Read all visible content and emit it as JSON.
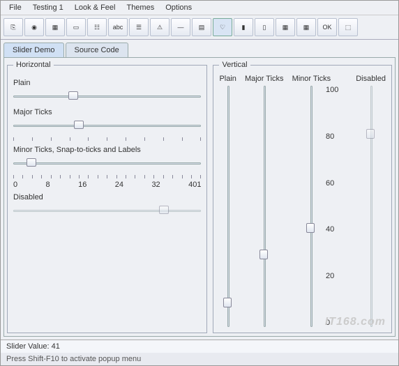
{
  "menu": [
    "File",
    "Testing 1",
    "Look & Feel",
    "Themes",
    "Options"
  ],
  "toolbarCount": 17,
  "tabs": [
    {
      "label": "Slider Demo",
      "active": true
    },
    {
      "label": "Source Code",
      "active": false
    }
  ],
  "horizontal": {
    "legend": "Horizontal",
    "sliders": [
      {
        "label": "Plain",
        "value": 32,
        "min": 0,
        "max": 100,
        "ticks": null,
        "disabled": false
      },
      {
        "label": "Major Ticks",
        "value": 35,
        "min": 0,
        "max": 100,
        "ticks": "major",
        "disabled": false
      },
      {
        "label": "Minor Ticks, Snap-to-ticks and Labels",
        "value": 4,
        "min": 0,
        "max": 41,
        "ticks": "labeled",
        "labels": [
          "0",
          "8",
          "16",
          "24",
          "32",
          "401"
        ],
        "disabled": false
      },
      {
        "label": "Disabled",
        "value": 80,
        "min": 0,
        "max": 100,
        "ticks": null,
        "disabled": true
      }
    ]
  },
  "vertical": {
    "legend": "Vertical",
    "columns": [
      {
        "label": "Plain",
        "value": 10,
        "min": 0,
        "max": 100,
        "disabled": false
      },
      {
        "label": "Major Ticks",
        "value": 30,
        "min": 0,
        "max": 100,
        "disabled": false
      },
      {
        "label": "Minor Ticks",
        "value": 41,
        "min": 0,
        "max": 100,
        "labels": [
          "100",
          "80",
          "60",
          "40",
          "20",
          "0"
        ],
        "disabled": false
      },
      {
        "label": "Disabled",
        "value": 80,
        "min": 0,
        "max": 100,
        "disabled": true
      }
    ]
  },
  "status": "Slider Value: 41",
  "footer": "Press Shift-F10 to activate popup menu",
  "watermark": "IT168.com"
}
